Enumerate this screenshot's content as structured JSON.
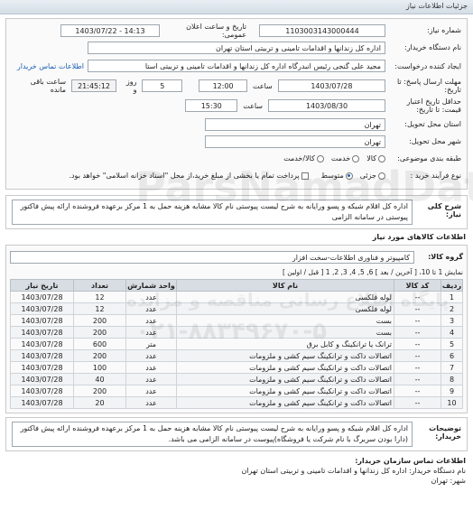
{
  "header": {
    "title": "جزئیات اطلاعات نیاز"
  },
  "fields": {
    "need_number_label": "شماره نیاز:",
    "need_number": "1103003143000444",
    "announce_label": "تاریخ و ساعت اعلان عمومی:",
    "announce_value": "1403/07/22 - 14:13",
    "buyer_label": "نام دستگاه خریدار:",
    "buyer_value": "اداره کل زندانها و اقدامات تامینی و تربیتی استان تهران",
    "creator_label": "ایجاد کننده درخواست:",
    "creator_value": "مجید علی گنجی رئیس انبدرگاه  اداره کل زندانها و اقدامات تامینی و تربیتی استا",
    "contact_link": "اطلاعات تماس خریدار",
    "reply_deadline_label": "مهلت ارسال پاسخ: تا تاریخ:",
    "reply_date": "1403/07/28",
    "time_word": "ساعت",
    "reply_time": "12:00",
    "day_count": "5",
    "day_word": "روز و",
    "remaining_time": "21:45:12",
    "remaining_label": "ساعت باقی مانده",
    "validity_label": "حداقل تاریخ اعتبار قیمت: تا تاریخ:",
    "validity_date": "1403/08/30",
    "validity_time": "15:30",
    "province_label": "استان محل تحویل:",
    "province_value": "تهران",
    "city_label": "شهر محل تحویل:",
    "city_value": "تهران",
    "category_label": "طبقه بندی موضوعی:",
    "category_options": [
      "کالا",
      "خدمت",
      "کالا/خدمت"
    ],
    "process_label": "نوع فرآیند خرید :",
    "process_options": [
      "جزئی",
      "متوسط"
    ],
    "payment_text": "پرداخت تمام یا بخشی از مبلغ خرید،از محل \"اسناد خزانه اسلامی\" خواهد بود."
  },
  "summary": {
    "label": "شرح کلی نیاز:",
    "text": "اداره کل اقلام شبکه و پسو ورایانه به شرح لیست پیوستی نام کالا مشابه هزینه حمل به 1 مرکز برعهده فروشنده ارائه پیش فاکتور پیوستی در سامانه الزامی"
  },
  "goods": {
    "section_title": "اطلاعات کالاهای مورد نیاز",
    "group_label": "گروه کالا:",
    "group_value": "کامپیوتر و فناوری اطلاعات-سخت افزار",
    "pager": "نمایش 1 تا 10، [ آخرین / بعد ] 6, 5, 4, 3, 2, 1 [ قبل / اولین ]",
    "columns": [
      "ردیف",
      "کد کالا",
      "نام کالا",
      "واحد شمارش",
      "تعداد",
      "تاریخ نیاز"
    ],
    "rows": [
      [
        "1",
        "--",
        "لوله فلکسی",
        "عدد",
        "12",
        "1403/07/28"
      ],
      [
        "2",
        "--",
        "لوله فلکسی",
        "عدد",
        "12",
        "1403/07/28"
      ],
      [
        "3",
        "--",
        "بست",
        "عدد",
        "200",
        "1403/07/28"
      ],
      [
        "4",
        "--",
        "بست",
        "عدد",
        "200",
        "1403/07/28"
      ],
      [
        "5",
        "--",
        "ترانک یا ترانکینگ و کابل برق",
        "متر",
        "600",
        "1403/07/28"
      ],
      [
        "6",
        "--",
        "اتصالات داکت و ترانکینگ سیم کشی و ملزومات",
        "عدد",
        "200",
        "1403/07/28"
      ],
      [
        "7",
        "--",
        "اتصالات داکت و ترانکینگ سیم کشی و ملزومات",
        "عدد",
        "100",
        "1403/07/28"
      ],
      [
        "8",
        "--",
        "اتصالات داکت و ترانکینگ سیم کشی و ملزومات",
        "عدد",
        "40",
        "1403/07/28"
      ],
      [
        "9",
        "--",
        "اتصالات داکت و ترانکینگ سیم کشی و ملزومات",
        "عدد",
        "200",
        "1403/07/28"
      ],
      [
        "10",
        "--",
        "اتصالات داکت و ترانکینگ سیم کشی و ملزومات",
        "عدد",
        "20",
        "1403/07/28"
      ]
    ]
  },
  "notes": {
    "label": "توضیحات خریدار:",
    "text": "اداره کل اقلام شبکه و پسو ورایانه به شرح لیست پیوستی نام کالا مشابه هزینه حمل به 1 مرکز برعهده فروشنده ارائه پیش فاکتور (دارا بودن سربرگ با نام شرکت یا فروشگاه)پیوست در سامانه الزامی می باشد."
  },
  "buyer_contact": {
    "section_title": "اطلاعات تماس سازمان خریدار:",
    "name_line": "نام دستگاه خریدار: اداره کل زندانها و اقدامات تامینی و تربیتی استان تهران",
    "city_line": "شهر: تهران"
  },
  "watermark": {
    "line1": "ParsNamadData",
    "line2": "پایگاه اطلاع رسانی مناقصه و مزایده",
    "line3": "۰۲۱-۸۸۳۴۹۶۷۰-۵"
  }
}
